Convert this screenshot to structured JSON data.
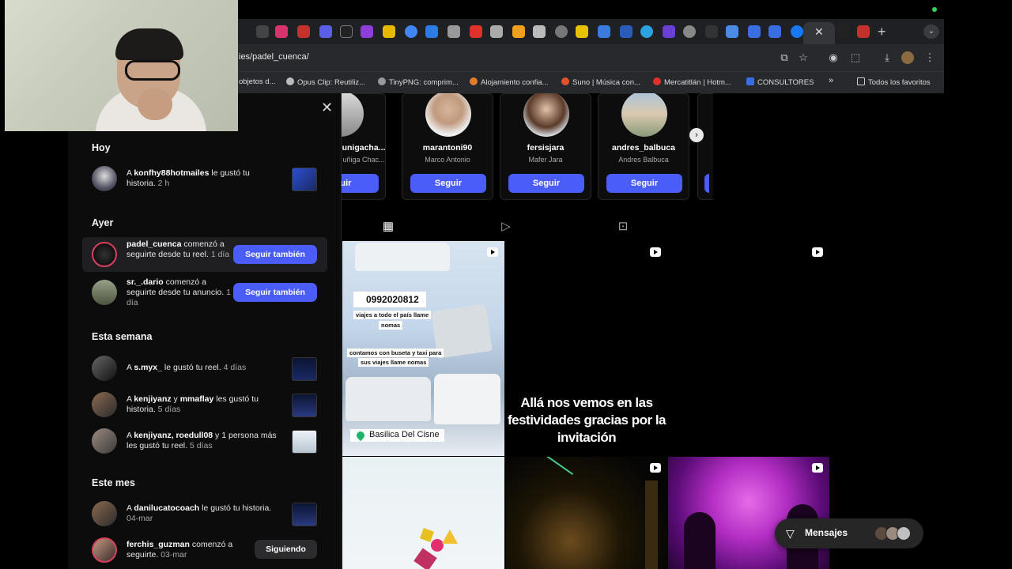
{
  "browser": {
    "url": "ies/padel_cuenca/",
    "new_tab_symbol": "+",
    "close_tab_symbol": "✕",
    "bookmarks": [
      {
        "label": "objetos d...",
        "color": "#666666"
      },
      {
        "label": "Opus Clip: Reutiliz...",
        "color": "#bbbbbb"
      },
      {
        "label": "TinyPNG: comprim...",
        "color": "#999999"
      },
      {
        "label": "Alojamiento confia...",
        "color": "#e07b2a"
      },
      {
        "label": "Suno | Música con...",
        "color": "#e0532a"
      },
      {
        "label": "Mercatitlán | Hotm...",
        "color": "#e0302a"
      },
      {
        "label": "CONSULTORES",
        "color": "#3a6ee0"
      }
    ],
    "bookmarks_more": "»",
    "all_bookmarks": "Todos los favoritos"
  },
  "notifications": {
    "close_symbol": "✕",
    "sections": {
      "today": "Hoy",
      "yesterday": "Ayer",
      "this_week": "Esta semana",
      "this_month": "Este mes"
    },
    "today": [
      {
        "prefix": "A ",
        "user": "konfhy88hotmailes",
        "text": " le gustó tu historia.",
        "time": " 2 h"
      }
    ],
    "yesterday": [
      {
        "user": "padel_cuenca",
        "text": " comenzó a seguirte desde tu reel.",
        "time": " 1 día",
        "button": "Seguir también"
      },
      {
        "user": "sr._.dario",
        "text": " comenzó a seguirte desde tu anuncio.",
        "time": " 1 día",
        "button": "Seguir también"
      }
    ],
    "this_week": [
      {
        "prefix": "A ",
        "user": "s.myx_",
        "text": " le gustó tu reel.",
        "time": " 4 días"
      },
      {
        "prefix": "A ",
        "user": "kenjiyanz",
        "joiner": " y ",
        "user2": "mmaflay",
        "text": " les gustó tu historia.",
        "time": " 5 días"
      },
      {
        "prefix": "A ",
        "user": "kenjiyanz, roedull08",
        "text": " y 1 persona más les gustó tu reel.",
        "time": " 5 días"
      }
    ],
    "this_month": [
      {
        "prefix": "A ",
        "user": "danilucatocoach",
        "text": " le gustó tu historia.",
        "time": " 04-mar"
      },
      {
        "user": "ferchis_guzman",
        "text": " comenzó a seguirte.",
        "time": " 03-mar",
        "button": "Siguiendo"
      }
    ]
  },
  "suggestions": {
    "cards": [
      {
        "username": "unigacha...",
        "name": "uñiga Chac...",
        "button": "eguir"
      },
      {
        "username": "marantoni90",
        "name": "Marco Antonio",
        "button": "Seguir"
      },
      {
        "username": "fersisjara",
        "name": "Mafer Jara",
        "button": "Seguir"
      },
      {
        "username": "andres_balbuca",
        "name": "Andres Balbuca",
        "button": "Seguir"
      }
    ],
    "next_symbol": "›"
  },
  "profile_tabs": [
    "posts-grid",
    "reels",
    "tagged"
  ],
  "posts": {
    "post1": {
      "phone": "0992020812",
      "line1": "viajes a todo el país llame",
      "line2": "nomas",
      "line3": "contamos con buseta y taxi para",
      "line4": "sus viajes llame nomas",
      "location": "Basilica Del Cisne"
    },
    "post2": {
      "caption": "Allá nos vemos en las festividades gracias por la invitación"
    }
  },
  "messages": {
    "label": "Mensajes"
  },
  "colors": {
    "accent_blue": "#4a5df9",
    "panel_bg": "#0c0c0c",
    "story_ring": "#d8405f"
  }
}
